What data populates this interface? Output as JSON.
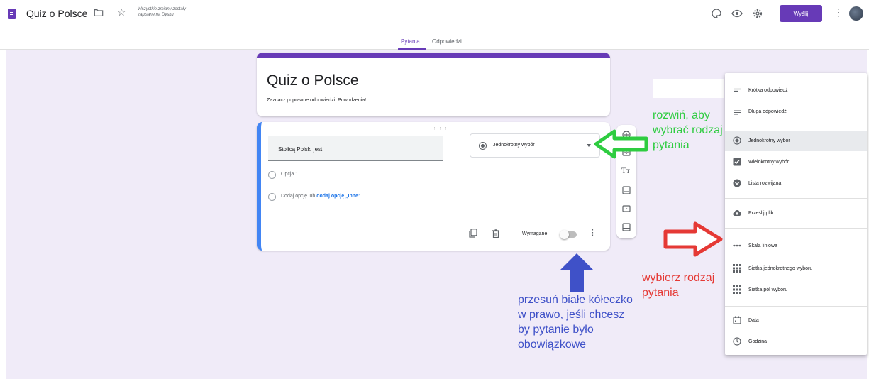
{
  "header": {
    "doc_title": "Quiz o Polsce",
    "save_note": "Wszystkie zmiany zostały zapisane na Dysku",
    "send_label": "Wyślij"
  },
  "tabs": [
    {
      "label": "Pytania",
      "active": true
    },
    {
      "label": "Odpowiedzi",
      "active": false
    }
  ],
  "form": {
    "title": "Quiz o Polsce",
    "description": "Zaznacz poprawne odpowiedzi. Powodzenia!"
  },
  "question": {
    "text": "Stolicą Polski jest",
    "type": "Jednokrotny wybór",
    "option1": "Opcja 1",
    "add_option_prefix": "Dodaj opcję lub",
    "add_option_link": "dodaj opcję „Inne”",
    "required_label": "Wymagane",
    "required": false
  },
  "menu": {
    "items": [
      {
        "label": "Krótka odpowiedź",
        "icon": "short-text-icon",
        "selected": false
      },
      {
        "label": "Długa odpowiedź",
        "icon": "paragraph-icon",
        "selected": false
      },
      {
        "label": "Jednokrotny wybór",
        "icon": "radio-icon",
        "selected": true
      },
      {
        "label": "Wielokrotny wybór",
        "icon": "checkbox-icon",
        "selected": false
      },
      {
        "label": "Lista rozwijana",
        "icon": "dropdown-icon",
        "selected": false
      },
      {
        "label": "Prześlij plik",
        "icon": "upload-cloud-icon",
        "selected": false
      },
      {
        "label": "Skala liniowa",
        "icon": "linear-scale-icon",
        "selected": false
      },
      {
        "label": "Siatka jednokrotnego wyboru",
        "icon": "grid-icon",
        "selected": false
      },
      {
        "label": "Siatka pól wyboru",
        "icon": "grid-icon",
        "selected": false
      },
      {
        "label": "Data",
        "icon": "calendar-icon",
        "selected": false
      },
      {
        "label": "Godzina",
        "icon": "clock-icon",
        "selected": false
      }
    ]
  },
  "annotations": {
    "green": "rozwiń, aby wybrać rodzaj pytania",
    "red": "wybierz rodzaj pytania",
    "blue": "przesuń białe kółeczko w prawo, jeśli chcesz by pytanie było obowiązkowe"
  },
  "colors": {
    "accent": "#673ab7",
    "question_border": "#4285f4",
    "green_note": "#2ecc40",
    "red_note": "#e53935",
    "blue_note": "#3f51c8"
  }
}
